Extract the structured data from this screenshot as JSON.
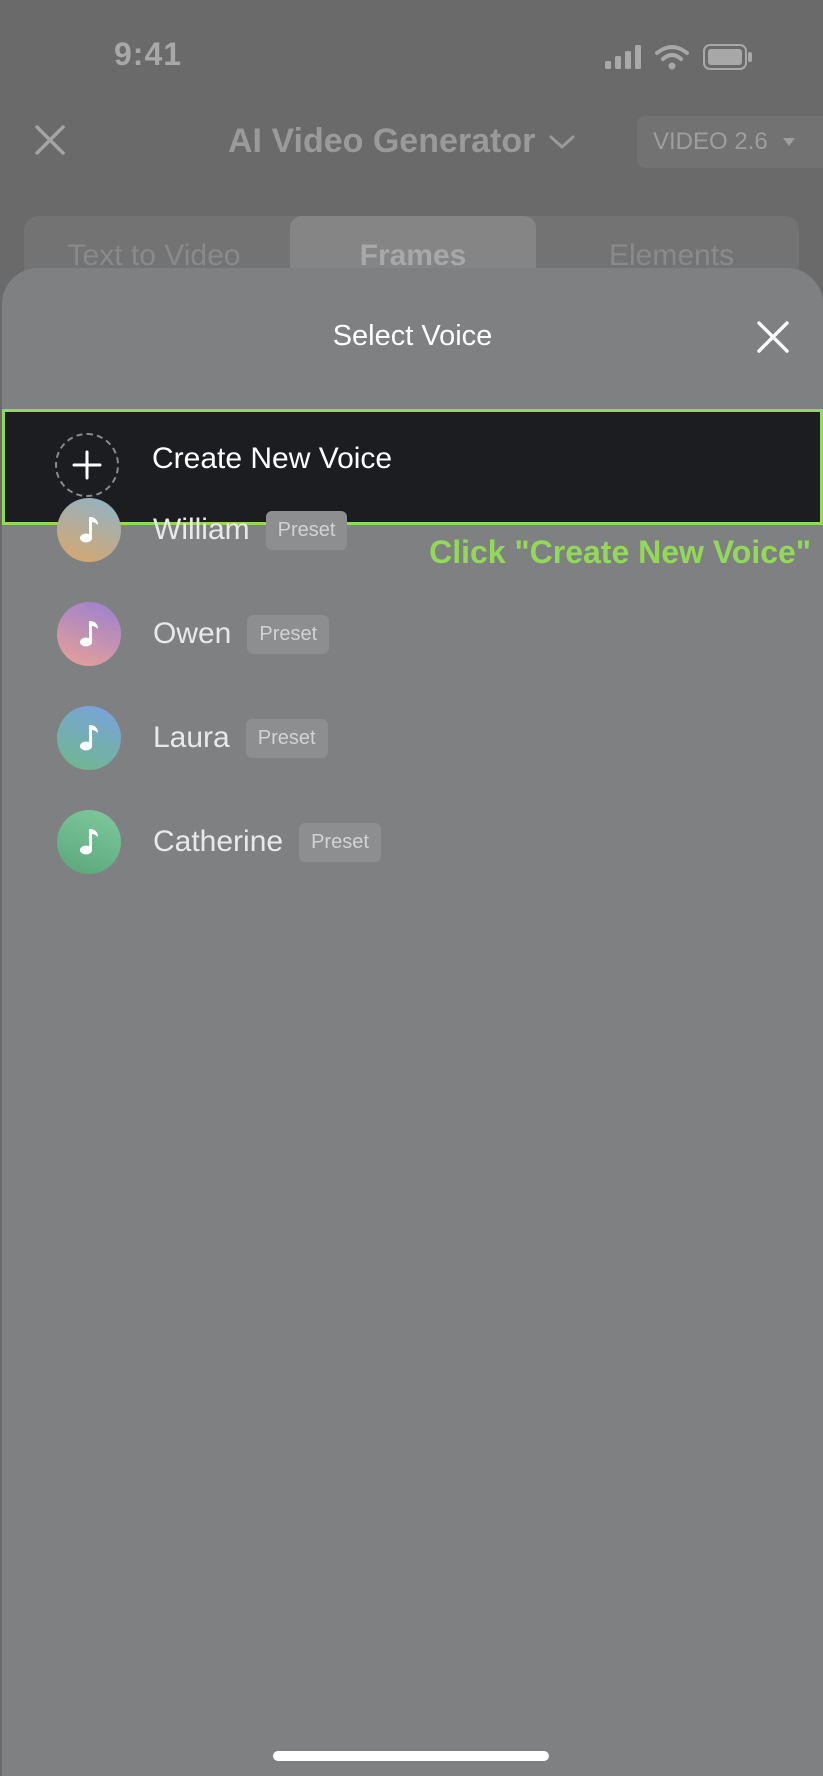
{
  "status_bar": {
    "time": "9:41"
  },
  "app_header": {
    "title": "AI Video Generator",
    "version_label": "VIDEO 2.6"
  },
  "mode_tabs": [
    {
      "label": "Text to Video",
      "active": false
    },
    {
      "label": "Frames",
      "active": true
    },
    {
      "label": "Elements",
      "active": false
    }
  ],
  "voice_sheet": {
    "title": "Select Voice",
    "create_label": "Create New Voice",
    "voices": [
      {
        "name": "William",
        "badge": "Preset",
        "avatar_colors": [
          "#8fb3c9",
          "#d9a66a"
        ]
      },
      {
        "name": "Owen",
        "badge": "Preset",
        "avatar_colors": [
          "#9a7fd1",
          "#e8a296"
        ]
      },
      {
        "name": "Laura",
        "badge": "Preset",
        "avatar_colors": [
          "#6fb88a",
          "#7aa2e0"
        ]
      },
      {
        "name": "Catherine",
        "badge": "Preset",
        "avatar_colors": [
          "#5aa679",
          "#80c9a0"
        ]
      }
    ]
  },
  "annotation": {
    "callout": "Click \"Create New Voice\"",
    "highlight_color": "#92d957"
  },
  "icons": {
    "close": "close-icon",
    "plus": "plus-icon",
    "music_note": "music-note-icon",
    "chevron_down": "chevron-down-icon",
    "caret_down": "caret-down-icon",
    "signal": "cellular-signal-icon",
    "wifi": "wifi-icon",
    "battery": "battery-icon"
  }
}
